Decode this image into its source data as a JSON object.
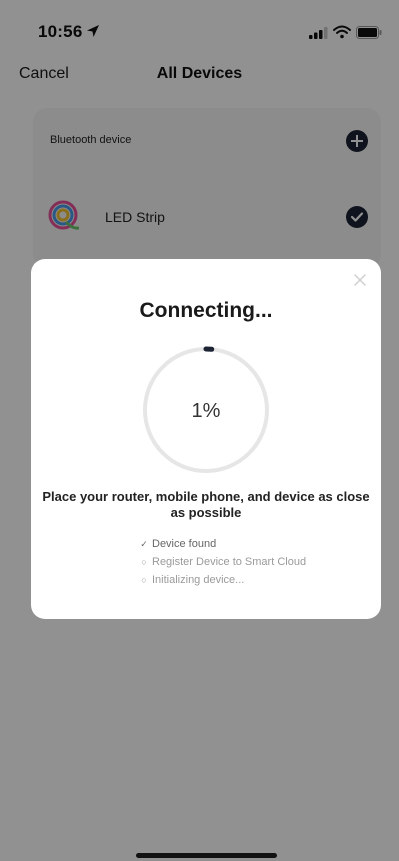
{
  "status_bar": {
    "time": "10:56"
  },
  "nav": {
    "cancel_label": "Cancel",
    "title": "All Devices"
  },
  "device_list": {
    "section_label": "Bluetooth device",
    "devices": [
      {
        "name": "LED Strip",
        "selected": true
      }
    ]
  },
  "modal": {
    "title": "Connecting...",
    "progress_percent": 1,
    "progress_label": "1%",
    "instruction": "Place your router, mobile phone, and device as close as possible",
    "steps": [
      {
        "label": "Device found",
        "status": "done"
      },
      {
        "label": "Register Device to Smart Cloud",
        "status": "pending"
      },
      {
        "label": "Initializing device...",
        "status": "pending"
      }
    ]
  },
  "colors": {
    "accent": "#1c2333",
    "overlay": "rgba(0,0,0,0.43)",
    "progress_track": "#e6e6e6"
  },
  "icons": [
    "location-arrow-icon",
    "signal-icon",
    "wifi-icon",
    "battery-icon",
    "plus-icon",
    "check-icon",
    "close-icon"
  ]
}
